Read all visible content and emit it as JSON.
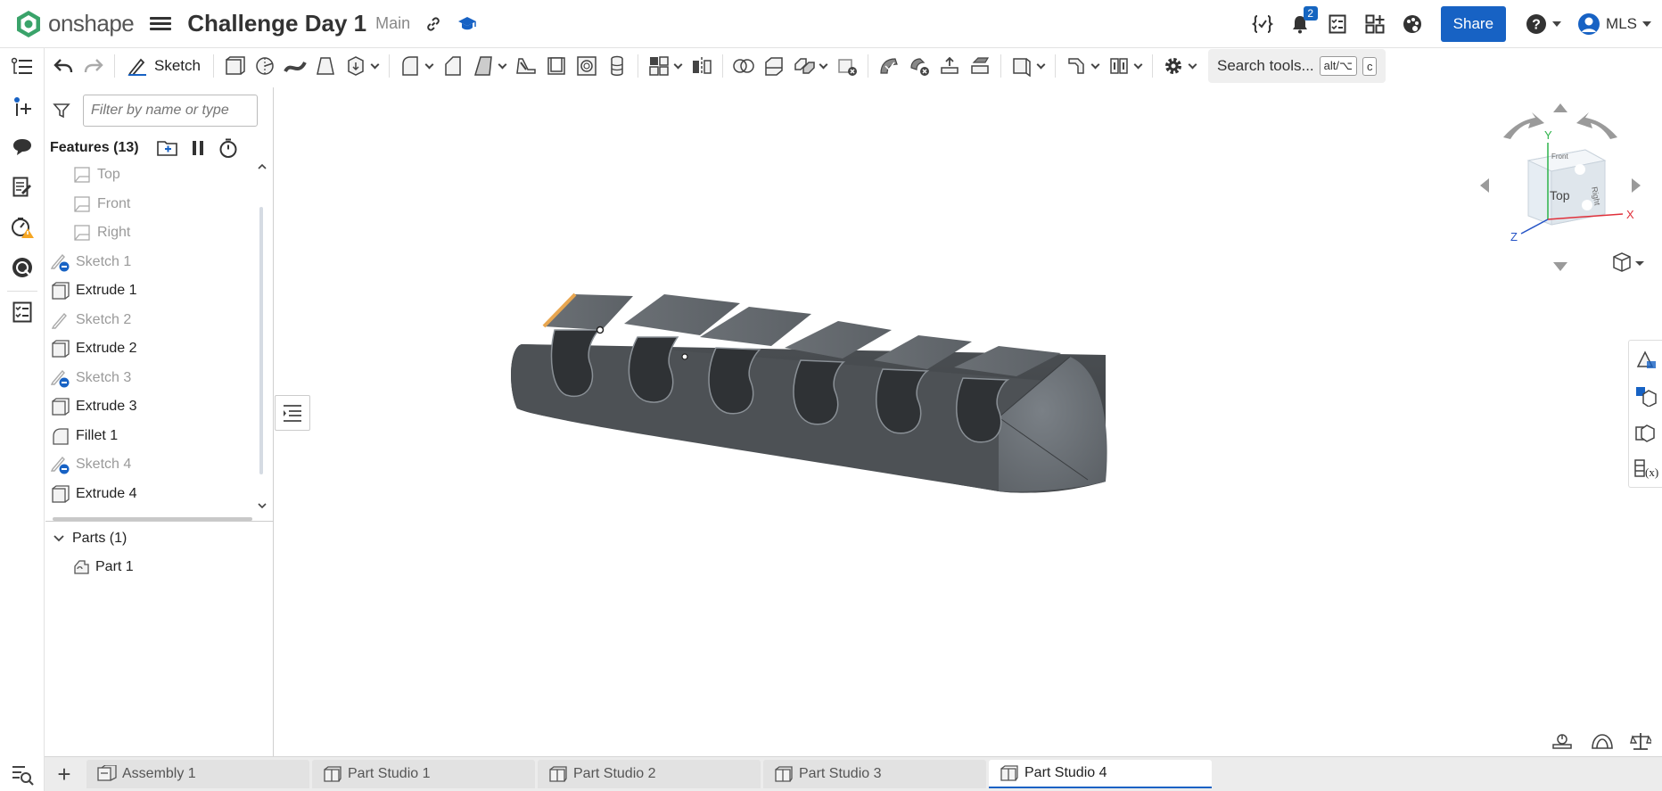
{
  "header": {
    "brand": "onshape",
    "document_title": "Challenge Day 1",
    "branch": "Main",
    "notification_count": "2",
    "share_label": "Share",
    "user_label": "MLS"
  },
  "toolbar": {
    "sketch_label": "Sketch",
    "search_label": "Search tools...",
    "shortcut_mod": "alt/⌥",
    "shortcut_key": "c"
  },
  "feature_panel": {
    "filter_placeholder": "Filter by name or type",
    "features_title": "Features (13)",
    "features": [
      {
        "name": "Top",
        "type": "plane",
        "state": "dim"
      },
      {
        "name": "Front",
        "type": "plane",
        "state": "dim"
      },
      {
        "name": "Right",
        "type": "plane",
        "state": "dim"
      },
      {
        "name": "Sketch 1",
        "type": "sketch-hidden",
        "state": "dim"
      },
      {
        "name": "Extrude 1",
        "type": "extrude",
        "state": "active"
      },
      {
        "name": "Sketch 2",
        "type": "sketch",
        "state": "dim"
      },
      {
        "name": "Extrude 2",
        "type": "extrude",
        "state": "active"
      },
      {
        "name": "Sketch 3",
        "type": "sketch-hidden",
        "state": "dim"
      },
      {
        "name": "Extrude 3",
        "type": "extrude",
        "state": "active"
      },
      {
        "name": "Fillet 1",
        "type": "fillet",
        "state": "active"
      },
      {
        "name": "Sketch 4",
        "type": "sketch-hidden",
        "state": "dim"
      },
      {
        "name": "Extrude 4",
        "type": "extrude",
        "state": "active"
      }
    ],
    "parts_title": "Parts (1)",
    "parts": [
      "Part 1"
    ]
  },
  "viewcube": {
    "face_top": "Top",
    "face_right": "Right",
    "face_front": "Front",
    "axis_x": "X",
    "axis_y": "Y",
    "axis_z": "Z"
  },
  "tabs": [
    {
      "label": "Assembly 1",
      "icon": "assembly-icon",
      "active": false
    },
    {
      "label": "Part Studio 1",
      "icon": "part-studio-icon",
      "active": false
    },
    {
      "label": "Part Studio 2",
      "icon": "part-studio-icon",
      "active": false
    },
    {
      "label": "Part Studio 3",
      "icon": "part-studio-icon",
      "active": false
    },
    {
      "label": "Part Studio 4",
      "icon": "part-studio-icon",
      "active": true
    }
  ],
  "colors": {
    "accent": "#1762c4",
    "model": "#5b5f63",
    "highlight": "#e8a650"
  }
}
